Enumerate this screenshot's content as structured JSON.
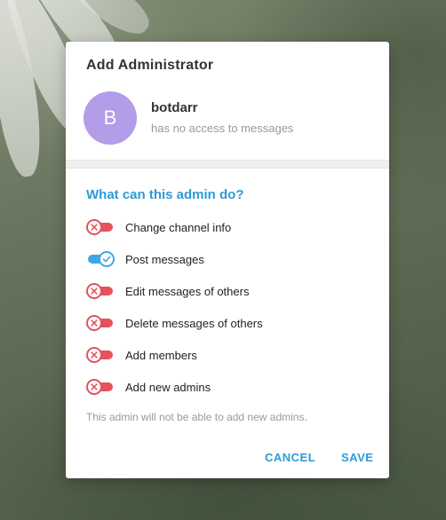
{
  "dialog": {
    "title": "Add Administrator",
    "user": {
      "avatar_letter": "B",
      "avatar_color": "#b39ce8",
      "name": "botdarr",
      "status": "has no access to messages"
    },
    "section_title": "What can this admin do?",
    "permissions": [
      {
        "label": "Change channel info",
        "enabled": false
      },
      {
        "label": "Post messages",
        "enabled": true
      },
      {
        "label": "Edit messages of others",
        "enabled": false
      },
      {
        "label": "Delete messages of others",
        "enabled": false
      },
      {
        "label": "Add members",
        "enabled": false
      },
      {
        "label": "Add new admins",
        "enabled": false
      }
    ],
    "hint": "This admin will not be able to add new admins.",
    "cancel_label": "CANCEL",
    "save_label": "SAVE"
  },
  "colors": {
    "accent": "#2e9ad6",
    "toggle_on": "#3fa7e3",
    "toggle_off": "#e3525e"
  },
  "icons": {
    "toggle_on": "check-icon",
    "toggle_off": "cross-icon"
  }
}
